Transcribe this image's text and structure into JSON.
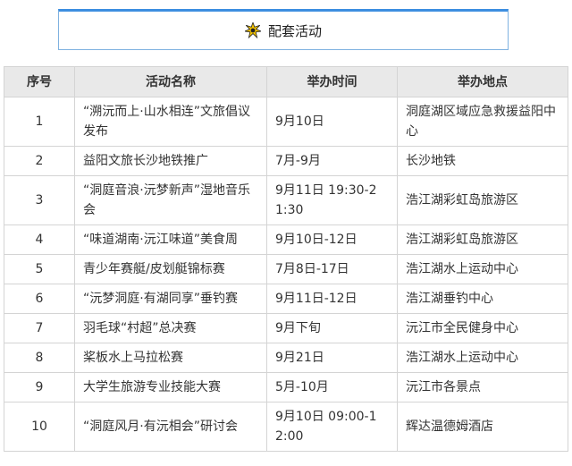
{
  "header": {
    "title": "配套活动",
    "icon": "star-burst-icon",
    "accent_color": "#3d8ee0"
  },
  "table": {
    "columns": [
      "序号",
      "活动名称",
      "举办时间",
      "举办地点"
    ],
    "rows": [
      {
        "no": "1",
        "name": "“溯沅而上·山水相连”文旅倡议发布",
        "time": "9月10日",
        "place": "洞庭湖区域应急救援益阳中心"
      },
      {
        "no": "2",
        "name": "益阳文旅长沙地铁推广",
        "time": "7月-9月",
        "place": "长沙地铁"
      },
      {
        "no": "3",
        "name": "“洞庭音浪·沅梦新声”湿地音乐会",
        "time": "9月11日 19:30-21:30",
        "place": "浩江湖彩虹岛旅游区"
      },
      {
        "no": "4",
        "name": "“味道湖南·沅江味道”美食周",
        "time": "9月10日-12日",
        "place": "浩江湖彩虹岛旅游区"
      },
      {
        "no": "5",
        "name": "青少年赛艇/皮划艇锦标赛",
        "time": "7月8日-17日",
        "place": "浩江湖水上运动中心"
      },
      {
        "no": "6",
        "name": "“沅梦洞庭·有湖同享”垂钓赛",
        "time": "9月11日-12日",
        "place": "浩江湖垂钓中心"
      },
      {
        "no": "7",
        "name": "羽毛球“村超”总决赛",
        "time": "9月下旬",
        "place": "沅江市全民健身中心"
      },
      {
        "no": "8",
        "name": "桨板水上马拉松赛",
        "time": "9月21日",
        "place": "浩江湖水上运动中心"
      },
      {
        "no": "9",
        "name": "大学生旅游专业技能大赛",
        "time": "5月-10月",
        "place": "沅江市各景点"
      },
      {
        "no": "10",
        "name": "“洞庭风月·有沅相会”研讨会",
        "time": "9月10日 09:00-12:00",
        "place": "辉达温德姆酒店"
      }
    ]
  }
}
